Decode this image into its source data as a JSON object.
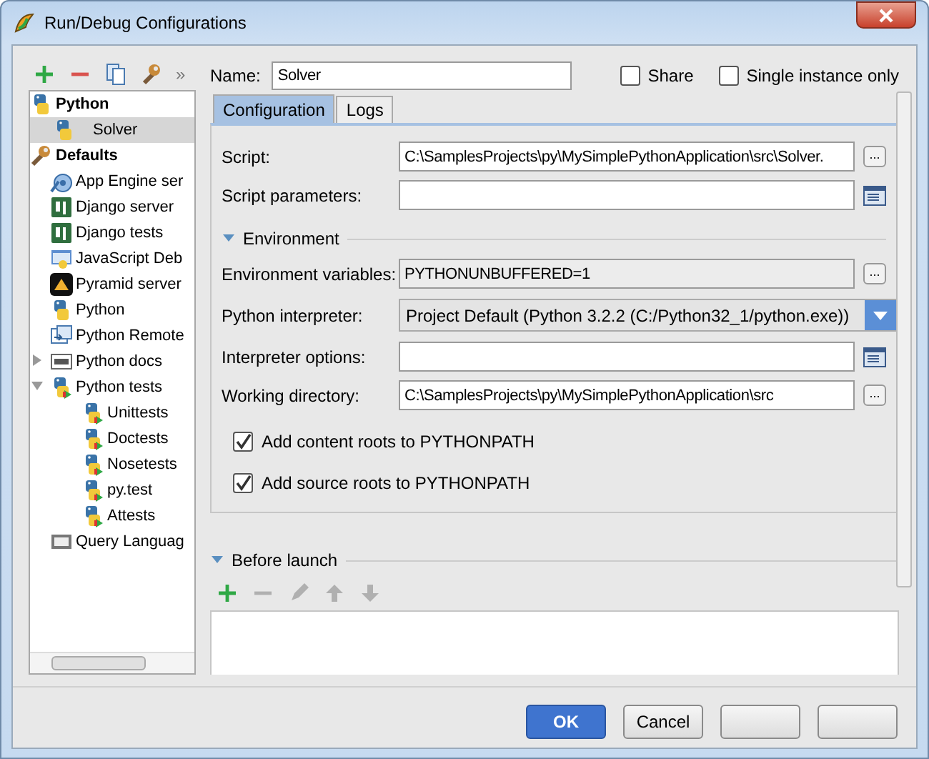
{
  "window": {
    "title": "Run/Debug Configurations"
  },
  "toolbar": {
    "tools": [
      {
        "kind": "add"
      },
      {
        "kind": "remove"
      },
      {
        "kind": "copy"
      },
      {
        "kind": "edit"
      }
    ],
    "overflow": "»"
  },
  "tree": [
    {
      "label": "Python",
      "expanded": true,
      "selected": false,
      "children": [
        {
          "label": "Solver",
          "selected": true
        }
      ]
    },
    {
      "label": "Defaults",
      "expanded": true,
      "selected": false,
      "children": [
        {
          "label": "App Engine ser",
          "selected": false
        },
        {
          "label": "Django server",
          "selected": false
        },
        {
          "label": "Django tests",
          "selected": false
        },
        {
          "label": "JavaScript Deb",
          "selected": false
        },
        {
          "label": "Pyramid server",
          "selected": false
        },
        {
          "label": "Python",
          "selected": false
        },
        {
          "label": "Python Remote",
          "selected": false
        },
        {
          "label": "Python docs",
          "selected": false,
          "expanded": false
        },
        {
          "label": "Python tests",
          "selected": false,
          "expanded": true,
          "children": [
            {
              "label": "Unittests",
              "selected": false
            },
            {
              "label": "Doctests",
              "selected": false
            },
            {
              "label": "Nosetests",
              "selected": false
            },
            {
              "label": "py.test",
              "selected": false
            },
            {
              "label": "Attests",
              "selected": false
            }
          ]
        },
        {
          "label": "Query Languag",
          "selected": false
        }
      ]
    }
  ],
  "name_field": {
    "label": "Name:",
    "value": "Solver"
  },
  "options": [
    {
      "label": "Share",
      "checked": false
    },
    {
      "label": "Single instance only",
      "checked": false
    }
  ],
  "tabs": [
    {
      "label": "Configuration",
      "selected": true
    },
    {
      "label": "Logs",
      "selected": false
    }
  ],
  "script_fields": [
    {
      "kind": "browse",
      "label": "Script:",
      "value": "C:\\SamplesProjects\\py\\MySimplePythonApplication\\src\\Solver.",
      "button": "..."
    },
    {
      "kind": "editor",
      "label": "Script parameters:"
    }
  ],
  "environment": {
    "label": "Environment",
    "expanded": true
  },
  "env_fields": [
    {
      "kind": "readonly_browse",
      "label": "Environment variables:",
      "value": "PYTHONUNBUFFERED=1",
      "button": "..."
    },
    {
      "kind": "dropdown",
      "label": "Python interpreter:",
      "value": "Project Default (Python 3.2.2 (C:/Python32_1/python.exe))"
    },
    {
      "kind": "editor",
      "label": "Interpreter options:"
    },
    {
      "kind": "browse",
      "label": "Working directory:",
      "value": "C:\\SamplesProjects\\py\\MySimplePythonApplication\\src",
      "button": "..."
    }
  ],
  "checkboxes": [
    {
      "label": "Add content roots to PYTHONPATH",
      "checked": true
    },
    {
      "label": "Add source roots to PYTHONPATH",
      "checked": true
    }
  ],
  "before_launch": {
    "label": "Before launch",
    "expanded": true,
    "tools": [
      {
        "kind": "add",
        "disabled": false
      },
      {
        "kind": "remove",
        "disabled": true
      },
      {
        "kind": "edit",
        "disabled": true
      },
      {
        "kind": "up",
        "disabled": true
      },
      {
        "kind": "down",
        "disabled": true
      }
    ]
  },
  "buttons": [
    {
      "label": "OK",
      "default": true
    },
    {
      "label": "Cancel",
      "default": false
    },
    {
      "default": false
    },
    {
      "default": false
    }
  ]
}
